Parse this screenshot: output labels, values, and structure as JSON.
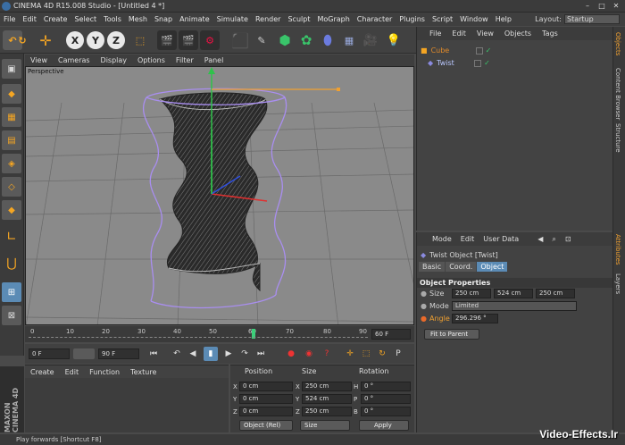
{
  "app": {
    "title": "CINEMA 4D R15.008 Studio - [Untitled 4 *]",
    "window_controls": [
      "–",
      "□",
      "✕"
    ]
  },
  "menubar": {
    "items": [
      "File",
      "Edit",
      "Create",
      "Select",
      "Tools",
      "Mesh",
      "Snap",
      "Animate",
      "Simulate",
      "Render",
      "Sculpt",
      "MoGraph",
      "Character",
      "Plugins",
      "Script",
      "Window",
      "Help"
    ],
    "layout_label": "Layout:",
    "layout_value": "Startup"
  },
  "toolbar": {
    "axis_x": "X",
    "axis_y": "Y",
    "axis_z": "Z"
  },
  "viewport": {
    "menu": [
      "View",
      "Cameras",
      "Display",
      "Options",
      "Filter",
      "Panel"
    ],
    "label": "Perspective"
  },
  "timeline": {
    "ticks": [
      "0",
      "10",
      "20",
      "30",
      "40",
      "50",
      "60",
      "70",
      "80",
      "90"
    ],
    "current_frame_label": "0 F",
    "end_field": "60 F"
  },
  "playback": {
    "start_field": "0 F",
    "end_field": "90 F"
  },
  "material_manager": {
    "menu": [
      "Create",
      "Edit",
      "Function",
      "Texture"
    ]
  },
  "coordinates": {
    "headers": [
      "Position",
      "Size",
      "Rotation"
    ],
    "rows": [
      {
        "axis": "X",
        "pos": "0 cm",
        "size_axis": "X",
        "size": "250 cm",
        "rot_axis": "H",
        "rot": "0 °"
      },
      {
        "axis": "Y",
        "pos": "0 cm",
        "size_axis": "Y",
        "size": "524 cm",
        "rot_axis": "P",
        "rot": "0 °"
      },
      {
        "axis": "Z",
        "pos": "0 cm",
        "size_axis": "Z",
        "size": "250 cm",
        "rot_axis": "B",
        "rot": "0 °"
      }
    ],
    "mode_select": "Object (Rel)",
    "size_select": "Size",
    "apply": "Apply"
  },
  "object_manager": {
    "menu": [
      "File",
      "Edit",
      "View",
      "Objects",
      "Tags"
    ],
    "objects": [
      {
        "name": "Cube",
        "color": "#e08a2a"
      },
      {
        "name": "Twist",
        "color": "#b9c7ff"
      }
    ]
  },
  "attributes": {
    "menu": [
      "Mode",
      "Edit",
      "User Data"
    ],
    "title": "Twist Object [Twist]",
    "tabs": [
      "Basic",
      "Coord.",
      "Object"
    ],
    "active_tab": "Object",
    "section": "Object Properties",
    "size_label": "Size",
    "size_values": [
      "250 cm",
      "524 cm",
      "250 cm"
    ],
    "mode_label": "Mode",
    "mode_value": "Limited",
    "angle_label": "Angle",
    "angle_value": "296.296 °",
    "fit_button": "Fit to Parent"
  },
  "side_tabs": [
    "Objects",
    "Content Browser",
    "Structure",
    "Attributes",
    "Layers"
  ],
  "status": "Play forwards [Shortcut F8]",
  "logo": "MAXON CINEMA 4D",
  "watermark": "Video-Effects.Ir",
  "colors": {
    "accent_blue": "#5b8bb5",
    "object_orange": "#e08a2a",
    "deformer_purple": "#a98ef0"
  }
}
